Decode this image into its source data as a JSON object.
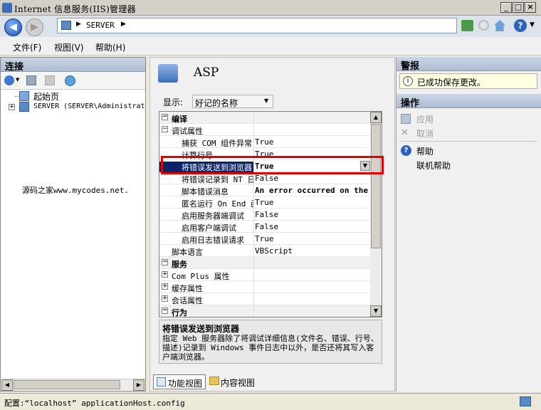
{
  "window": {
    "title": "Internet 信息服务(IIS)管理器"
  },
  "address": {
    "path": "SERVER",
    "arrow": "▶"
  },
  "menu": [
    "文件(F)",
    "视图(V)",
    "帮助(H)"
  ],
  "connections": {
    "header": "连接",
    "tree": [
      "起始页",
      "SERVER (SERVER\\Administrat"
    ],
    "watermark": "源码之家www.mycodes.net."
  },
  "center": {
    "title": "ASP",
    "display_label": "显示:",
    "display_value": "好记的名称",
    "rows": [
      {
        "name": "编译",
        "value": "",
        "type": "cat",
        "expand": "−"
      },
      {
        "name": "调试属性",
        "value": "",
        "type": "sub",
        "expand": "−"
      },
      {
        "name": "捕获 COM 组件异常",
        "value": "True",
        "type": "item"
      },
      {
        "name": "计算行号",
        "value": "True",
        "type": "item"
      },
      {
        "name": "将错误发送到浏览器",
        "value": "True",
        "type": "selected"
      },
      {
        "name": "将错误记录到 NT 日志",
        "value": "False",
        "type": "item"
      },
      {
        "name": "脚本错误消息",
        "value": "An error occurred on the",
        "type": "item"
      },
      {
        "name": "匿名运行 On End 函数",
        "value": "True",
        "type": "item"
      },
      {
        "name": "启用服务器端调试",
        "value": "False",
        "type": "item"
      },
      {
        "name": "启用客户端调试",
        "value": "False",
        "type": "item"
      },
      {
        "name": "启用日志错误请求",
        "value": "True",
        "type": "item"
      },
      {
        "name": "脚本语言",
        "value": "VBScript",
        "type": "item2"
      },
      {
        "name": "服务",
        "value": "",
        "type": "cat",
        "expand": "−"
      },
      {
        "name": "Com Plus 属性",
        "value": "",
        "type": "sub",
        "expand": "+"
      },
      {
        "name": "缓存属性",
        "value": "",
        "type": "sub",
        "expand": "+"
      },
      {
        "name": "会话属性",
        "value": "",
        "type": "sub",
        "expand": "+"
      },
      {
        "name": "行为",
        "value": "",
        "type": "cat",
        "expand": "−"
      }
    ],
    "desc_title": "将错误发送到浏览器",
    "desc_text": "指定 Web 服务器除了将调试详细信息(文件名、错误、行号、描述)记录到 Windows 事件日志中以外，是否还将其写入客户端浏览器。",
    "tabs": [
      "功能视图",
      "内容视图"
    ]
  },
  "alerts": {
    "header": "警报",
    "message": "已成功保存更改。"
  },
  "actions": {
    "header": "操作",
    "apply": "应用",
    "cancel": "取消",
    "help": "帮助",
    "online_help": "联机帮助"
  },
  "status": {
    "text": "配置:“localhost” applicationHost.config"
  },
  "colors": {
    "selection": "#0a246a",
    "highlight_box": "#e00000"
  }
}
